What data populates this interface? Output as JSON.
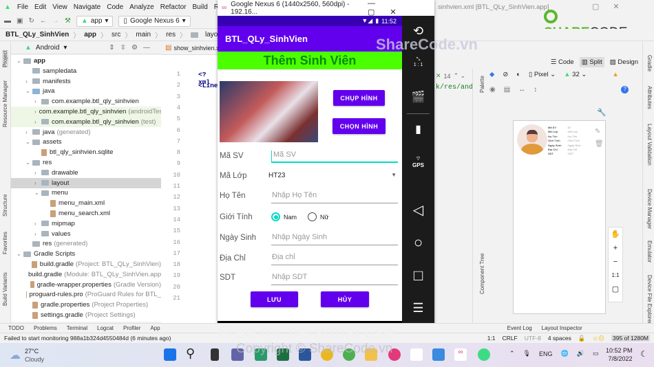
{
  "ide": {
    "menu": [
      "File",
      "Edit",
      "View",
      "Navigate",
      "Code",
      "Analyze",
      "Refactor",
      "Build",
      "Run"
    ],
    "run_config": "app",
    "device": "Google Nexus 6",
    "breadcrumb": [
      "BTL_QLy_SinhVien",
      "app",
      "src",
      "main",
      "res",
      "layout"
    ],
    "window_title": "sinhvien.xml [BTL_QLy_SinhVien.app]",
    "project_view": "Android",
    "side_tabs_left": [
      "Project",
      "Resource Manager",
      "Structure",
      "Favorites",
      "Build Variants"
    ],
    "side_tabs_right": [
      "Gradle",
      "Attributes",
      "Layout Validation",
      "Device Manager",
      "Emulator",
      "Device File Explorer"
    ],
    "editor_tab": "show_sinhvien.xml",
    "code_lines": [
      "1",
      "2",
      "3",
      "4",
      "5",
      "6",
      "7",
      "8",
      "9",
      "10",
      "11",
      "12",
      "13",
      "14",
      "15",
      "16",
      "17",
      "18",
      "19",
      "20",
      "21"
    ],
    "code_snippets": [
      "<?xml",
      "<Line"
    ],
    "tree": [
      {
        "label": "app",
        "depth": 0,
        "exp": "v",
        "bold": true
      },
      {
        "label": "sampledata",
        "depth": 1
      },
      {
        "label": "manifests",
        "depth": 1,
        "exp": ">"
      },
      {
        "label": "java",
        "depth": 1,
        "exp": "v"
      },
      {
        "label": "com.example.btl_qly_sinhvien",
        "depth": 2,
        "exp": ">"
      },
      {
        "label": "com.example.btl_qly_sinhvien",
        "note": "(androidTest)",
        "depth": 2,
        "exp": ">",
        "hl": true
      },
      {
        "label": "com.example.btl_qly_sinhvien",
        "note": "(test)",
        "depth": 2,
        "exp": ">",
        "hl": true
      },
      {
        "label": "java",
        "note": "(generated)",
        "depth": 1,
        "exp": ">"
      },
      {
        "label": "assets",
        "depth": 1,
        "exp": "v"
      },
      {
        "label": "btl_qly_sinhvien.sqlite",
        "depth": 2,
        "file": true
      },
      {
        "label": "res",
        "depth": 1,
        "exp": "v"
      },
      {
        "label": "drawable",
        "depth": 2,
        "exp": ">"
      },
      {
        "label": "layout",
        "depth": 2,
        "exp": ">",
        "sel": true
      },
      {
        "label": "menu",
        "depth": 2,
        "exp": "v"
      },
      {
        "label": "menu_main.xml",
        "depth": 3,
        "file": true
      },
      {
        "label": "menu_search.xml",
        "depth": 3,
        "file": true
      },
      {
        "label": "mipmap",
        "depth": 2,
        "exp": ">"
      },
      {
        "label": "values",
        "depth": 2,
        "exp": ">"
      },
      {
        "label": "res",
        "note": "(generated)",
        "depth": 1
      },
      {
        "label": "Gradle Scripts",
        "depth": 0,
        "exp": "v"
      },
      {
        "label": "build.gradle",
        "note": "(Project: BTL_QLy_SinhVien)",
        "depth": 1,
        "file": true
      },
      {
        "label": "build.gradle",
        "note": "(Module: BTL_QLy_SinhVien.app)",
        "depth": 1,
        "file": true
      },
      {
        "label": "gradle-wrapper.properties",
        "note": "(Gradle Version)",
        "depth": 1,
        "file": true
      },
      {
        "label": "proguard-rules.pro",
        "note": "(ProGuard Rules for BTL_",
        "depth": 1,
        "file": true
      },
      {
        "label": "gradle.properties",
        "note": "(Project Properties)",
        "depth": 1,
        "file": true
      },
      {
        "label": "settings.gradle",
        "note": "(Project Settings)",
        "depth": 1,
        "file": true
      }
    ],
    "view_modes": [
      "Code",
      "Split",
      "Design"
    ],
    "active_view": "Split",
    "design_toolbar": {
      "device": "Pixel",
      "api": "32",
      "warnings": "14"
    },
    "palette": "Palette",
    "component_tree": "Component Tree",
    "preview_fields": [
      [
        "Mã SV",
        ":ID"
      ],
      [
        "Mã Lớp",
        ":Mã Lớp"
      ],
      [
        "Họ Tên",
        ":Họ Tên"
      ],
      [
        "Giới Tính",
        ":Giới Tính"
      ],
      [
        "Ngày Sinh",
        ":Ngày Sinh"
      ],
      [
        "Địa Chỉ",
        ":Địa Chỉ"
      ],
      [
        "SDT",
        ":SDT"
      ]
    ],
    "zoom_label": "1:1",
    "bottom_tools": [
      "TODO",
      "Problems",
      "Terminal",
      "Logcat",
      "Profiler",
      "App"
    ],
    "bottom_tools_right": [
      "Event Log",
      "Layout Inspector"
    ],
    "status_message": "Failed to start monitoring 988a1b324d4550484d (6 minutes ago)",
    "status_right": [
      "1:1",
      "CRLF",
      "UTF-8",
      "4 spaces"
    ],
    "memory": "395 of 1280M"
  },
  "emulator": {
    "title": "Google Nexus 6 (1440x2560, 560dpi) - 192.16...",
    "time": "11:52",
    "app_title": "BTL_QLy_SinhVien",
    "banner": "Thêm Sinh Viên",
    "btn_capture": "CHỤP HÌNH",
    "btn_choose": "CHỌN HÌNH",
    "fields": [
      {
        "label": "Mã SV",
        "placeholder": "Mã SV"
      },
      {
        "label": "Mã Lớp",
        "value": "HT23"
      },
      {
        "label": "Họ Tên",
        "placeholder": "Nhập Họ Tên"
      },
      {
        "label": "Giới Tính"
      },
      {
        "label": "Ngày Sinh",
        "placeholder": "Nhập Ngày Sinh"
      },
      {
        "label": "Địa Chỉ",
        "placeholder": "Địa chỉ"
      },
      {
        "label": "SDT",
        "placeholder": "Nhập SDT"
      }
    ],
    "gender_options": [
      "Nam",
      "Nữ"
    ],
    "gender_selected": "Nam",
    "btn_save": "LƯU",
    "btn_cancel": "HỦY",
    "gps": "GPS",
    "scale": "1 : 1",
    "colors": {
      "primary": "#6200EE",
      "status": "#3700B3",
      "banner": "#4cff00",
      "accent": "#03DAC5"
    }
  },
  "taskbar": {
    "weather_temp": "27°C",
    "weather_desc": "Cloudy",
    "lang": "ENG",
    "time": "10:52 PM",
    "date": "7/8/2022"
  },
  "watermarks": {
    "logo": "SHARECODE.vn",
    "top": "ShareCode.vn",
    "middle": "Free for personal use",
    "bottom": "Copyright © ShareCode.vn"
  }
}
